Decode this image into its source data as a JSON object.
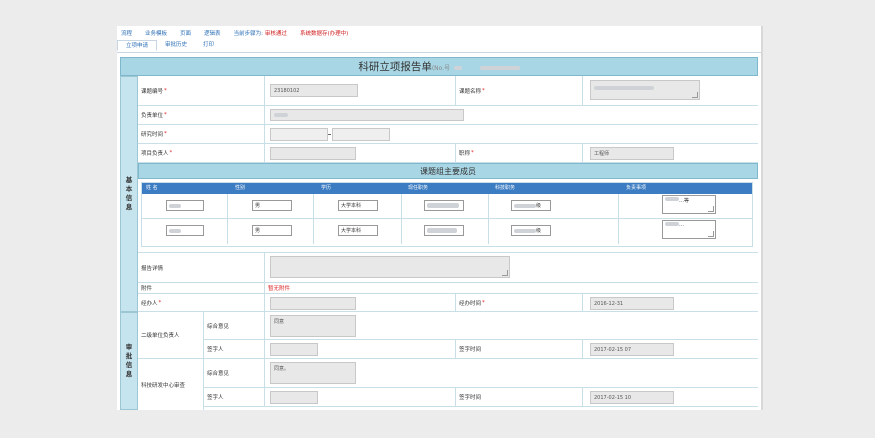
{
  "topnav": {
    "items": [
      "流程",
      "业务模板",
      "页面",
      "逻辑表",
      "当前步骤为:"
    ],
    "current_step": "审核通过",
    "status": "系统数据存(办理中)"
  },
  "tabs": [
    "立项申请",
    "审批历史",
    "打印"
  ],
  "form": {
    "title": "科研立项报告单",
    "title_suffix": "(No.号",
    "basic_section_label": [
      "基",
      "本",
      "信",
      "息"
    ],
    "approval_section_label": [
      "审",
      "批",
      "信",
      "息"
    ],
    "fields": {
      "project_no_label": "课题编号",
      "project_no_value": "23180102",
      "project_name_label": "课题名称",
      "unit_label": "负责单位",
      "period_label": "研究时间",
      "leader_label": "项目负责人",
      "title_rank_label": "职称",
      "title_rank_value": "工程师",
      "report_detail_label": "报告详情",
      "attachment_label": "附件",
      "attachment_value": "暂无附件",
      "handler_label": "经办人",
      "handle_time_label": "经办时间",
      "handle_time_value": "2016-12-31"
    },
    "members": {
      "title": "课题组主要成员",
      "headers": [
        "姓 名",
        "性别",
        "学历",
        "现任职务",
        "科技职务",
        "负责事项"
      ],
      "rows": [
        {
          "gender": "男",
          "education": "大学本科",
          "duty_suffix": "",
          "tech_suffix": "级",
          "task": "…等"
        },
        {
          "gender": "男",
          "education": "大学本科",
          "duty_suffix": "",
          "tech_suffix": "级",
          "task": "…"
        }
      ]
    },
    "approval": {
      "group1_label": "二级单位负责人",
      "group2_label": "科技研发中心审查",
      "opinion_label": "综合意见",
      "signer_label": "签字人",
      "sign_time_label": "签字时间",
      "opinion1": "同意",
      "opinion2": "同意。",
      "time1": "2017-02-15 07",
      "time2": "2017-02-15 10"
    }
  },
  "colors": {
    "accent": "#3b7cc2",
    "title_bg": "#a9d6e5",
    "required": "#d22222"
  }
}
